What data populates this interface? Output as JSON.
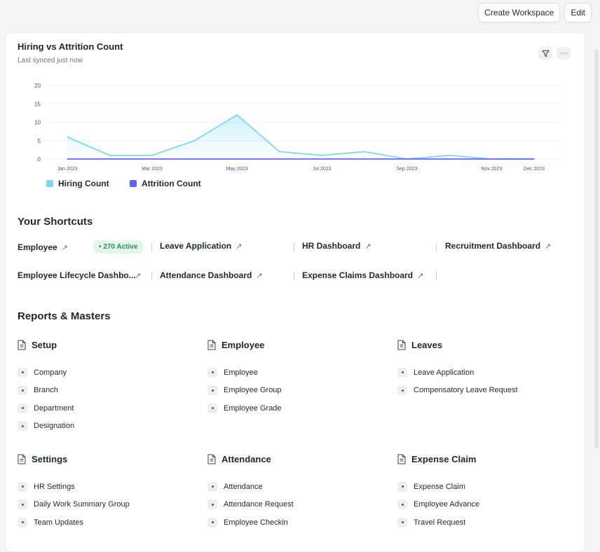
{
  "toolbar": {
    "create_workspace": "Create Workspace",
    "edit": "Edit"
  },
  "chart": {
    "title": "Hiring vs Attrition Count",
    "subtitle": "Last synced just now",
    "filter_icon": "filter-icon",
    "more_icon": "more-icon",
    "more_label": "···"
  },
  "chart_data": {
    "type": "line",
    "x": [
      "Jan 2023",
      "Feb 2023",
      "Mar 2023",
      "Apr 2023",
      "May 2023",
      "Jun 2023",
      "Jul 2023",
      "Aug 2023",
      "Sep 2023",
      "Oct 2023",
      "Nov 2023",
      "Dec 2023"
    ],
    "xtick_labels": [
      "Jan 2023",
      "",
      "Mar 2023",
      "",
      "May 2023",
      "",
      "Jul 2023",
      "",
      "Sep 2023",
      "",
      "Nov 2023",
      "Dec 2023"
    ],
    "series": [
      {
        "name": "Hiring Count",
        "color": "#7cd6f7",
        "values": [
          6,
          1,
          1,
          5,
          12,
          2,
          1,
          2,
          0,
          1,
          0,
          0
        ]
      },
      {
        "name": "Attrition Count",
        "color": "#5e64ff",
        "values": [
          0,
          0,
          0,
          0,
          0,
          0,
          0,
          0,
          0,
          0,
          0,
          0
        ]
      }
    ],
    "yticks": [
      0,
      5,
      10,
      15,
      20
    ],
    "ylim": [
      0,
      20
    ],
    "grid": true,
    "legend_position": "bottom-left"
  },
  "shortcuts": {
    "title": "Your Shortcuts",
    "items": [
      {
        "label": "Employee"
      },
      {
        "label": "Leave Application"
      },
      {
        "label": "HR Dashboard"
      },
      {
        "label": "Recruitment Dashboard"
      },
      {
        "label": "Employee Lifecycle Dashbo..."
      },
      {
        "label": "Attendance Dashboard"
      },
      {
        "label": "Expense Claims Dashboard"
      }
    ],
    "employee_badge": "• 270 Active",
    "arrow": "↗"
  },
  "reports": {
    "title": "Reports & Masters",
    "groups": [
      {
        "title": "Setup",
        "items": [
          "Company",
          "Branch",
          "Department",
          "Designation"
        ]
      },
      {
        "title": "Employee",
        "items": [
          "Employee",
          "Employee Group",
          "Employee Grade"
        ]
      },
      {
        "title": "Leaves",
        "items": [
          "Leave Application",
          "Compensatory Leave Request"
        ]
      },
      {
        "title": "Settings",
        "items": [
          "HR Settings",
          "Daily Work Summary Group",
          "Team Updates"
        ]
      },
      {
        "title": "Attendance",
        "items": [
          "Attendance",
          "Attendance Request",
          "Employee Checkin"
        ]
      },
      {
        "title": "Expense Claim",
        "items": [
          "Expense Claim",
          "Employee Advance",
          "Travel Request"
        ]
      }
    ]
  }
}
